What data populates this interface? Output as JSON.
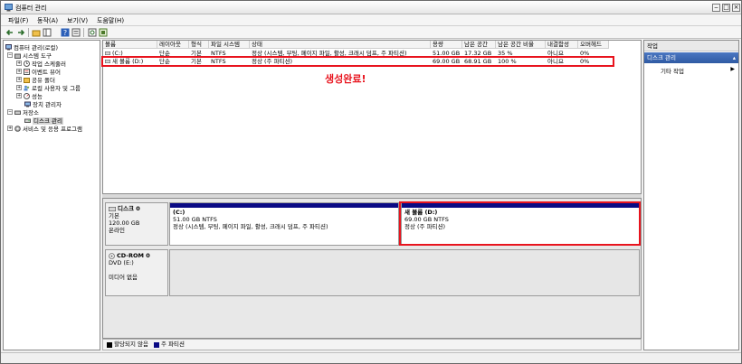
{
  "window": {
    "title": "컴퓨터 관리"
  },
  "menu": [
    "파일(F)",
    "동작(A)",
    "보기(V)",
    "도움말(H)"
  ],
  "tree": {
    "root": "컴퓨터 관리(로컬)",
    "system_tools": "시스템 도구",
    "task_scheduler": "작업 스케줄러",
    "event_viewer": "이벤트 뷰어",
    "shared_folders": "공유 폴더",
    "local_users": "로컬 사용자 및 그룹",
    "performance": "성능",
    "device_manager": "장치 관리자",
    "storage": "저장소",
    "disk_management": "디스크 관리",
    "services": "서비스 및 응용 프로그램"
  },
  "volume_table": {
    "headers": [
      "볼륨",
      "레이아웃",
      "형식",
      "파일 시스템",
      "상태",
      "용량",
      "남은 공간",
      "남은 공간 비율",
      "내결함성",
      "오버헤드"
    ],
    "rows": [
      [
        "(C:)",
        "단순",
        "기본",
        "NTFS",
        "정상 (시스템, 부팅, 페이지 파일, 활성, 크래시 덤프, 주 파티션)",
        "51.00 GB",
        "17.32 GB",
        "35 %",
        "아니요",
        "0%"
      ],
      [
        "새 볼륨 (D:)",
        "단순",
        "기본",
        "NTFS",
        "정상 (주 파티션)",
        "69.00 GB",
        "68.91 GB",
        "100 %",
        "아니요",
        "0%"
      ]
    ]
  },
  "annotation": "생성완료!",
  "disks": {
    "disk0": {
      "name": "디스크 0",
      "type": "기본",
      "size": "120.00 GB",
      "status": "온라인",
      "partitions": [
        {
          "name": "(C:)",
          "size": "51.00 GB NTFS",
          "status": "정상 (시스템, 부팅, 페이지 파일, 활성, 크래시 덤프, 주 파티션)"
        },
        {
          "name": "새 볼륨  (D:)",
          "size": "69.00 GB NTFS",
          "status": "정상 (주 파티션)"
        }
      ]
    },
    "cdrom0": {
      "name": "CD-ROM 0",
      "type": "DVD (E:)",
      "status": "미디어 없음"
    }
  },
  "legend": [
    {
      "label": "할당되지 않음",
      "color": "#000000"
    },
    {
      "label": "주 파티션",
      "color": "#0a0a84"
    }
  ],
  "actions": {
    "header": "작업",
    "section": "디스크 관리",
    "item": "기타 작업"
  },
  "colors": {
    "highlight": "#e8141e",
    "partition_bar": "#0a0a84",
    "action_section": "#3a65b0"
  }
}
